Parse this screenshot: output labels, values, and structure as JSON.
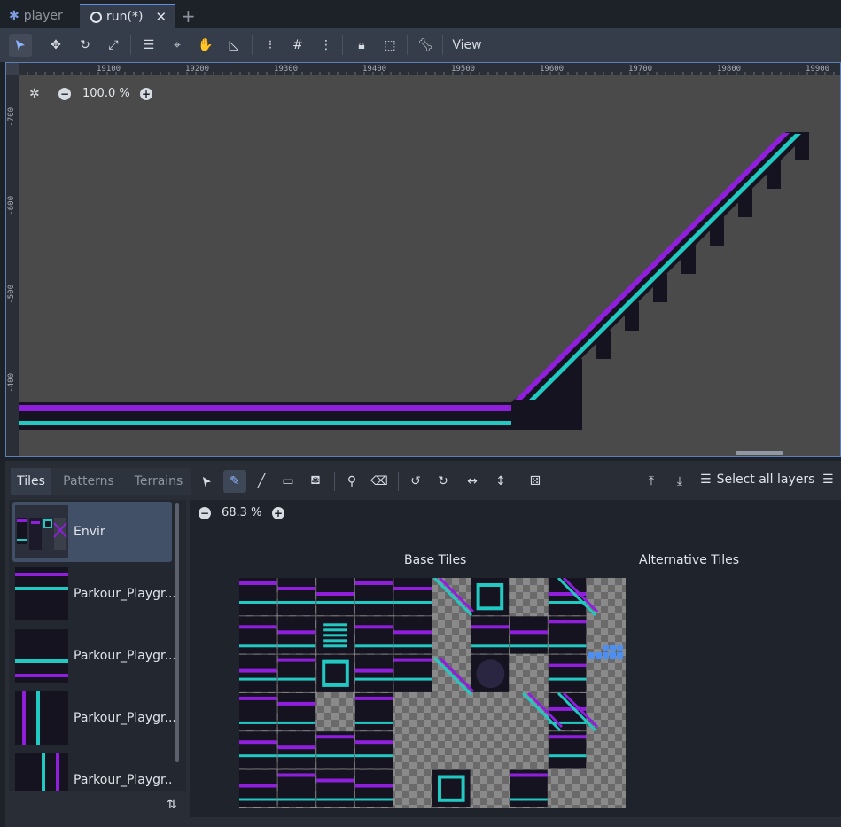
{
  "tabs": [
    {
      "label": "player",
      "icon": "player-scene-icon"
    },
    {
      "label": "run(*)",
      "icon": "node-circle-icon"
    }
  ],
  "toolbar": {
    "view_label": "View",
    "icons": [
      "select-icon",
      "move-icon",
      "rotate-icon",
      "scale-icon",
      "list-select-icon",
      "pivot-icon",
      "pan-icon",
      "ruler-icon",
      "smart-snap-icon",
      "grid-snap-icon",
      "more-icon",
      "lock-icon",
      "group-icon",
      "bone-icon"
    ]
  },
  "viewport": {
    "zoom": "100.0 %",
    "ruler_x": [
      "19100",
      "19200",
      "19300",
      "19400",
      "19500",
      "19600",
      "19700",
      "19800",
      "19900"
    ],
    "ruler_y": [
      "-700",
      "-600",
      "-500",
      "-400"
    ],
    "colors": {
      "purple": "#8f1fdc",
      "teal": "#21c9c2",
      "dark": "#15131f",
      "background": "#4a4a4a"
    }
  },
  "bottom_panel": {
    "tabs": [
      "Tiles",
      "Patterns",
      "Terrains"
    ],
    "select_all_layers": "Select all layers",
    "tools": [
      "select-icon",
      "paint-icon",
      "line-icon",
      "rect-icon",
      "bucket-icon",
      "picker-icon",
      "eraser-icon",
      "rotate-left-icon",
      "rotate-right-icon",
      "flip-h-icon",
      "flip-v-icon",
      "random-icon"
    ],
    "sources": [
      {
        "name": "Envir",
        "selected": true
      },
      {
        "name": "Parkour_Playgr...",
        "selected": false
      },
      {
        "name": "Parkour_Playgr...",
        "selected": false
      },
      {
        "name": "Parkour_Playgr...",
        "selected": false
      },
      {
        "name": "Parkour_Playgr...",
        "selected": false
      }
    ],
    "atlas_zoom": "68.3 %",
    "base_tiles_label": "Base Tiles",
    "alternative_tiles_label": "Alternative Tiles"
  }
}
